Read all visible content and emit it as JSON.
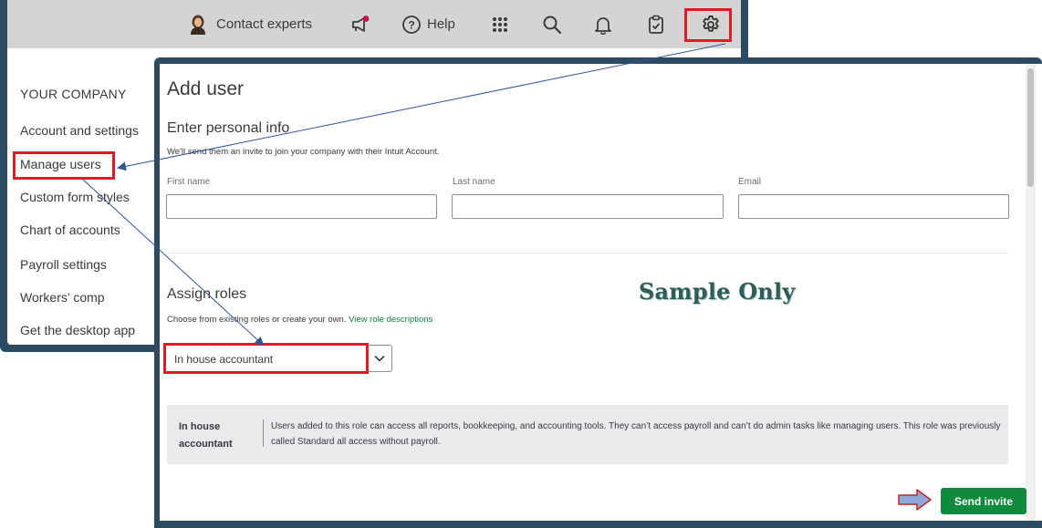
{
  "topbar": {
    "contact_experts": "Contact experts",
    "help": "Help",
    "icons": [
      "expert-avatar-icon",
      "megaphone-icon",
      "help-icon",
      "apps-grid-icon",
      "search-icon",
      "bell-icon",
      "clipboard-icon",
      "gear-icon"
    ]
  },
  "settings_menu": {
    "heading": "YOUR COMPANY",
    "items": [
      "Account and settings",
      "Manage users",
      "Custom form styles",
      "Chart of accounts",
      "Payroll settings",
      "Workers’ comp",
      "Get the desktop app"
    ]
  },
  "dialog": {
    "title": "Add user",
    "personal_info": {
      "heading": "Enter personal info",
      "subtext": "We'll send them an invite to join your company with their Intuit Account.",
      "first_name_label": "First name",
      "last_name_label": "Last name",
      "email_label": "Email",
      "first_name_value": "",
      "last_name_value": "",
      "email_value": ""
    },
    "roles": {
      "heading": "Assign roles",
      "subtext": "Choose from existing roles or create your own.",
      "link": "View role descriptions",
      "selected_role": "In house accountant",
      "info_name": "In house accountant",
      "info_desc": "Users added to this role can access all reports, bookkeeping, and accounting tools. They can’t access payroll and can’t do admin tasks like managing users. This role was previously called Standard all access without payroll."
    },
    "send_button": "Send invite"
  },
  "watermark": "Sample Only",
  "colors": {
    "panel_border": "#2d4a63",
    "highlight": "#e01b24",
    "primary_button": "#108a3c",
    "link": "#0e7f3f",
    "annotation_arrow": "#2f5597"
  }
}
